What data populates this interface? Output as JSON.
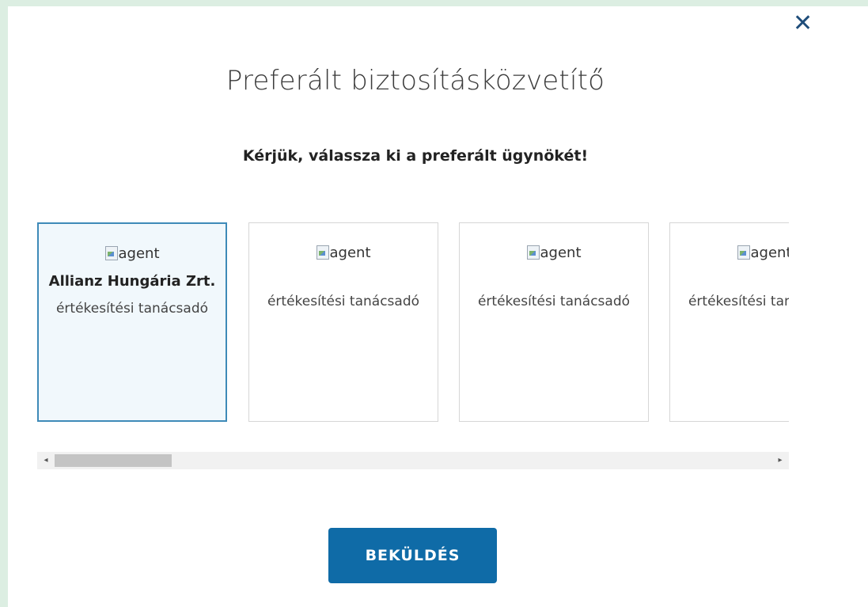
{
  "close": {
    "symbol": "✕"
  },
  "title": "Preferált biztosításközvetítő",
  "subtitle": "Kérjük, válassza ki a preferált ügynökét!",
  "cards": [
    {
      "img_alt": "agent",
      "company": "Allianz Hungária Zrt.",
      "role": "értékesítési tanácsadó",
      "selected": true
    },
    {
      "img_alt": "agent",
      "company": "",
      "role": "értékesítési tanácsadó",
      "selected": false
    },
    {
      "img_alt": "agent",
      "company": "",
      "role": "értékesítési tanácsadó",
      "selected": false
    },
    {
      "img_alt": "agent",
      "company": "",
      "role": "értékesítési tanácsadó",
      "selected": false
    }
  ],
  "scrollbar": {
    "left_arrow": "◂",
    "right_arrow": "▸"
  },
  "submit_label": "BEKÜLDÉS",
  "colors": {
    "accent": "#0f6ba7",
    "selected_border": "#3e8ab8",
    "backdrop": "#dceee2"
  }
}
